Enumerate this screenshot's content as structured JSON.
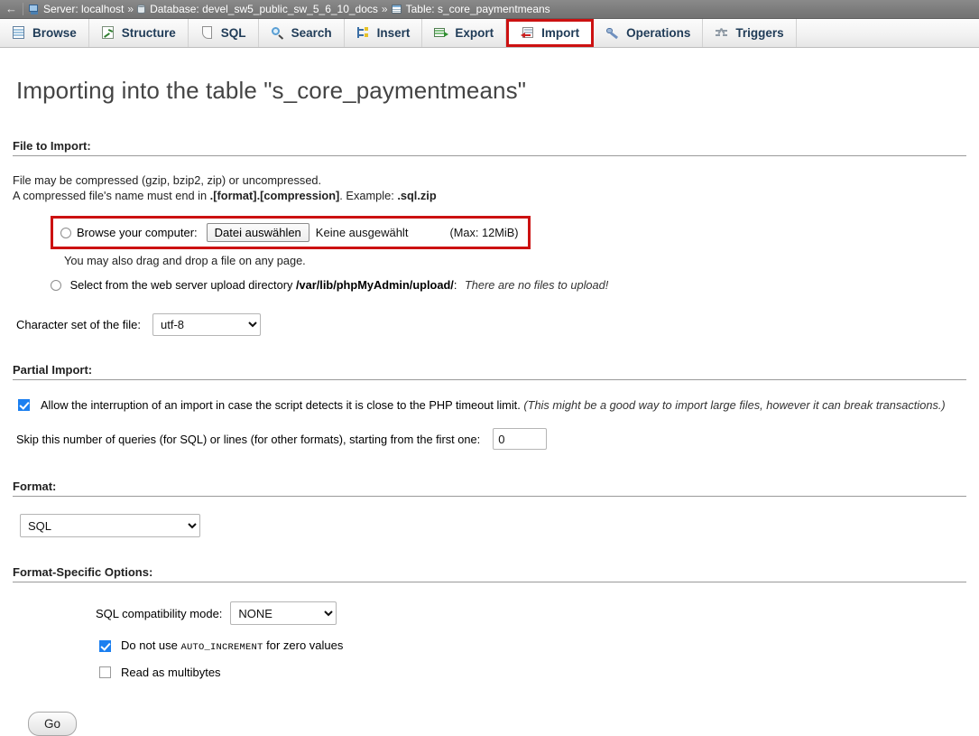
{
  "breadcrumb": {
    "back_arrow": "←",
    "server_label": "Server: localhost",
    "sep1": "»",
    "database_label": "Database: devel_sw5_public_sw_5_6_10_docs",
    "sep2": "»",
    "table_label": "Table: s_core_paymentmeans"
  },
  "tabs": [
    {
      "label": "Browse",
      "icon": "browse-icon",
      "active": false
    },
    {
      "label": "Structure",
      "icon": "structure-icon",
      "active": false
    },
    {
      "label": "SQL",
      "icon": "sql-icon",
      "active": false
    },
    {
      "label": "Search",
      "icon": "search-icon",
      "active": false
    },
    {
      "label": "Insert",
      "icon": "insert-icon",
      "active": false
    },
    {
      "label": "Export",
      "icon": "export-icon",
      "active": false
    },
    {
      "label": "Import",
      "icon": "import-icon",
      "active": true
    },
    {
      "label": "Operations",
      "icon": "operations-icon",
      "active": false
    },
    {
      "label": "Triggers",
      "icon": "triggers-icon",
      "active": false
    }
  ],
  "page_title": "Importing into the table \"s_core_paymentmeans\"",
  "file_to_import": {
    "heading": "File to Import:",
    "desc_line1": "File may be compressed (gzip, bzip2, zip) or uncompressed.",
    "desc_line2_pre": "A compressed file's name must end in ",
    "desc_line2_bold1": ".[format].[compression]",
    "desc_line2_mid": ". Example: ",
    "desc_line2_bold2": ".sql.zip",
    "browse_label": "Browse your computer:",
    "file_button_label": "Datei auswählen",
    "file_status": "Keine ausgewählt",
    "max_label": "(Max: 12MiB)",
    "drag_drop_note": "You may also drag and drop a file on any page.",
    "upload_dir_pre": "Select from the web server upload directory ",
    "upload_dir_path": "/var/lib/phpMyAdmin/upload/",
    "upload_dir_colon": ":",
    "upload_dir_note": "There are no files to upload!",
    "charset_label": "Character set of the file:",
    "charset_value": "utf-8",
    "charset_options": [
      "utf-8"
    ]
  },
  "partial_import": {
    "heading": "Partial Import:",
    "allow_interrupt_label": "Allow the interruption of an import in case the script detects it is close to the PHP timeout limit.",
    "allow_interrupt_note": "(This might be a good way to import large files, however it can break transactions.)",
    "allow_interrupt_checked": true,
    "skip_label": "Skip this number of queries (for SQL) or lines (for other formats), starting from the first one:",
    "skip_value": "0"
  },
  "format": {
    "heading": "Format:",
    "value": "SQL",
    "options": [
      "SQL"
    ]
  },
  "format_specific": {
    "heading": "Format-Specific Options:",
    "compat_label": "SQL compatibility mode:",
    "compat_value": "NONE",
    "compat_options": [
      "NONE"
    ],
    "auto_increment_pre": "Do not use ",
    "auto_increment_mono": "AUTO_INCREMENT",
    "auto_increment_post": " for zero values",
    "auto_increment_checked": true,
    "multibytes_label": "Read as multibytes",
    "multibytes_checked": false
  },
  "submit": {
    "go_label": "Go"
  },
  "colors": {
    "breadcrumb_bg": "#7d7d7d",
    "tab_text": "#1f3b57",
    "highlight_red": "#cc1111",
    "checkbox_blue": "#1b7ff0",
    "title_gray": "#444444"
  }
}
